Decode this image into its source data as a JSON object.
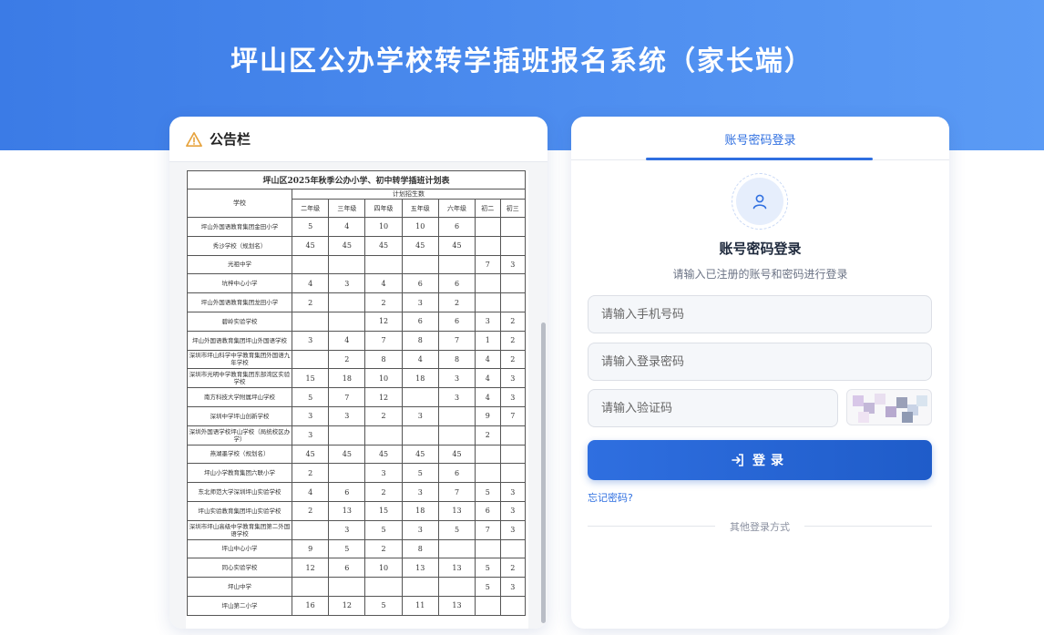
{
  "page": {
    "title": "坪山区公办学校转学插班报名系统（家长端）"
  },
  "notice": {
    "title": "公告栏",
    "icon": "warning-icon",
    "table": {
      "caption": "坪山区2025年秋季公办小学、初中转学插班计划表",
      "school_header": "学校",
      "group_header": "计划招生数",
      "grades": [
        "二年级",
        "三年级",
        "四年级",
        "五年级",
        "六年级",
        "初二",
        "初三"
      ],
      "rows": [
        {
          "school": "坪山外国语教育集团金田小学",
          "cells": [
            "5",
            "4",
            "10",
            "10",
            "6",
            "",
            ""
          ]
        },
        {
          "school": "秀沙学校（规划名）",
          "cells": [
            "45",
            "45",
            "45",
            "45",
            "45",
            "",
            ""
          ]
        },
        {
          "school": "光祖中学",
          "cells": [
            "",
            "",
            "",
            "",
            "",
            "7",
            "3"
          ]
        },
        {
          "school": "坑梓中心小学",
          "cells": [
            "4",
            "3",
            "4",
            "6",
            "6",
            "",
            ""
          ]
        },
        {
          "school": "坪山外国语教育集团龙田小学",
          "cells": [
            "2",
            "",
            "2",
            "3",
            "2",
            "",
            ""
          ]
        },
        {
          "school": "碧岭实验学校",
          "cells": [
            "",
            "",
            "12",
            "6",
            "6",
            "3",
            "2"
          ]
        },
        {
          "school": "坪山外国语教育集团坪山外国语学校",
          "cells": [
            "3",
            "4",
            "7",
            "8",
            "7",
            "1",
            "2"
          ]
        },
        {
          "school": "深圳市坪山科学中学教育集团外国语九年学校",
          "cells": [
            "",
            "2",
            "8",
            "4",
            "8",
            "4",
            "2"
          ]
        },
        {
          "school": "深圳市光明中学教育集团东部湾区实验学校",
          "cells": [
            "15",
            "18",
            "10",
            "18",
            "3",
            "4",
            "3"
          ]
        },
        {
          "school": "南方科技大学附属坪山学校",
          "cells": [
            "5",
            "7",
            "12",
            "",
            "3",
            "4",
            "3"
          ]
        },
        {
          "school": "深圳中学坪山创新学校",
          "cells": [
            "3",
            "3",
            "2",
            "3",
            "",
            "9",
            "7"
          ]
        },
        {
          "school": "深圳外国语学校坪山学校（局统校区办学）",
          "cells": [
            "3",
            "",
            "",
            "",
            "",
            "2",
            ""
          ]
        },
        {
          "school": "燕湖墨学校（规划名）",
          "cells": [
            "45",
            "45",
            "45",
            "45",
            "45",
            "",
            ""
          ]
        },
        {
          "school": "坪山小学教育集团六联小学",
          "cells": [
            "2",
            "",
            "3",
            "5",
            "6",
            "",
            ""
          ]
        },
        {
          "school": "东北师范大学深圳坪山实验学校",
          "cells": [
            "4",
            "6",
            "2",
            "3",
            "7",
            "5",
            "3"
          ]
        },
        {
          "school": "坪山实验教育集团坪山实验学校",
          "cells": [
            "2",
            "13",
            "15",
            "18",
            "13",
            "6",
            "3"
          ]
        },
        {
          "school": "深圳市坪山高级中学教育集团第二外国语学校",
          "cells": [
            "",
            "3",
            "5",
            "3",
            "5",
            "7",
            "3"
          ]
        },
        {
          "school": "坪山中心小学",
          "cells": [
            "9",
            "5",
            "2",
            "8",
            "",
            "",
            ""
          ]
        },
        {
          "school": "同心实验学校",
          "cells": [
            "12",
            "6",
            "10",
            "13",
            "13",
            "5",
            "2"
          ]
        },
        {
          "school": "坪山中学",
          "cells": [
            "",
            "",
            "",
            "",
            "",
            "5",
            "3"
          ]
        },
        {
          "school": "坪山第二小学",
          "cells": [
            "16",
            "12",
            "5",
            "11",
            "13",
            "",
            ""
          ]
        }
      ]
    }
  },
  "login": {
    "tab_label": "账号密码登录",
    "avatar_icon": "user-icon",
    "title": "账号密码登录",
    "subtitle": "请输入已注册的账号和密码进行登录",
    "phone_placeholder": "请输入手机号码",
    "password_placeholder": "请输入登录密码",
    "code_placeholder": "请输入验证码",
    "submit_label": "登录",
    "submit_icon": "login-icon",
    "forgot_label": "忘记密码?",
    "other_label": "其他登录方式"
  },
  "colors": {
    "brand": "#2f6fe0",
    "hero": "#4f8ff0",
    "warning": "#e6a23c"
  }
}
